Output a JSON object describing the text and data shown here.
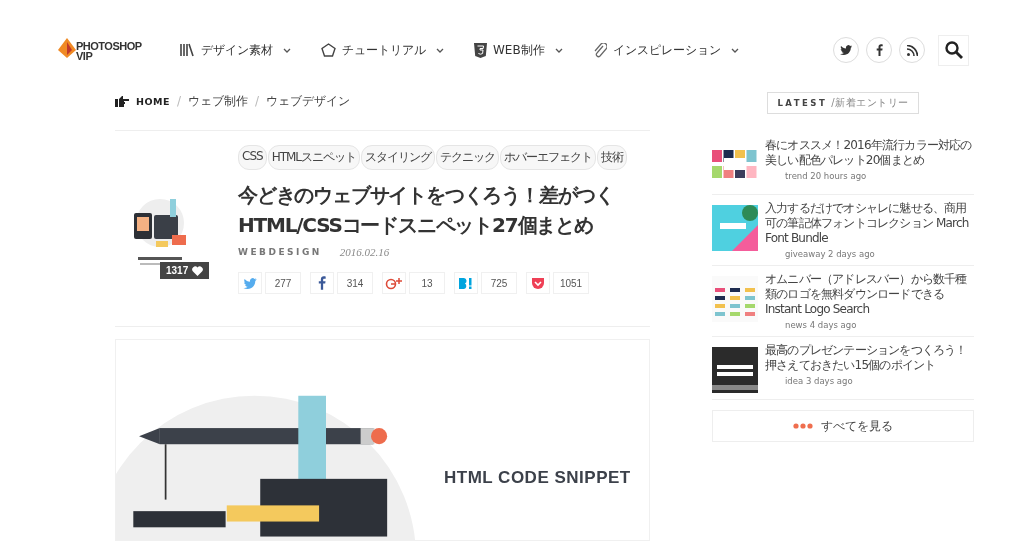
{
  "logo": {
    "line_1": "PHOTOSHOP",
    "line_2": "VIP"
  },
  "nav": [
    {
      "label": "デザイン素材"
    },
    {
      "label": "チュートリアル"
    },
    {
      "label": "WEB制作"
    },
    {
      "label": "インスピレーション"
    }
  ],
  "social": [
    {
      "kind": "twitter"
    },
    {
      "kind": "facebook"
    },
    {
      "kind": "rss"
    }
  ],
  "breadcrumb": {
    "items": [
      "HOME",
      "ウェブ制作",
      "ウェブデザイン"
    ],
    "separator": "/"
  },
  "tags": [
    "CSS",
    "HTMLスニペット",
    "スタイリング",
    "テクニック",
    "ホバーエフェクト",
    "技術"
  ],
  "article": {
    "title": "今どきのウェブサイトをつくろう！差がつくHTML/CSSコードスニペット27個まとめ",
    "likes": "1317",
    "category": "WEBDESIGN",
    "date": "2016.02.16",
    "shares": [
      {
        "kind": "twitter",
        "count": "277"
      },
      {
        "kind": "facebook",
        "count": "314"
      },
      {
        "kind": "gplus",
        "count": "13"
      },
      {
        "kind": "hatena",
        "count": "725"
      },
      {
        "kind": "pocket",
        "count": "1051"
      }
    ],
    "hero_caption": "HTML CODE SNIPPET"
  },
  "sidebar": {
    "heading": "LATEST",
    "subheading": "/新着エントリー",
    "entries": [
      {
        "title": "春にオススメ！2016年流行カラー対応の美しい配色パレット20個まとめ",
        "meta": "trend 20 hours ago"
      },
      {
        "title": "入力するだけでオシャレに魅せる、商用可の筆記体フォントコレクション March Font Bundle",
        "meta": "giveaway 2 days ago"
      },
      {
        "title": "オムニバー（アドレスバー）から数千種類のロゴを無料ダウンロードできる Instant Logo Search",
        "meta": "news 4 days ago"
      },
      {
        "title": "最高のプレゼンテーションをつくろう！押さえておきたい15個のポイント",
        "meta": "idea 3 days ago"
      }
    ],
    "more": "すべてを見る"
  }
}
